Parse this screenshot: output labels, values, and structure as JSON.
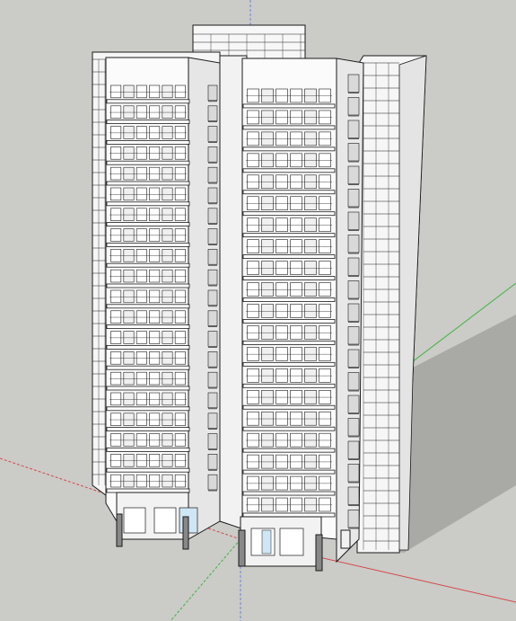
{
  "scene": {
    "description_tag": "3d-model-viewport",
    "colors": {
      "background": "#cbcbc8",
      "wall_lit": "#f7f7f7",
      "wall_shade": "#e2e2e2",
      "edge": "#1a1a1a",
      "shadow": "#a8a8a6",
      "glass": "#cfe6f5",
      "axis_red": "#d44a4a",
      "axis_green": "#3fb43f",
      "axis_blue": "#6f80d8"
    },
    "model": {
      "floors": 20,
      "towers": 2,
      "window_columns": 6
    }
  }
}
